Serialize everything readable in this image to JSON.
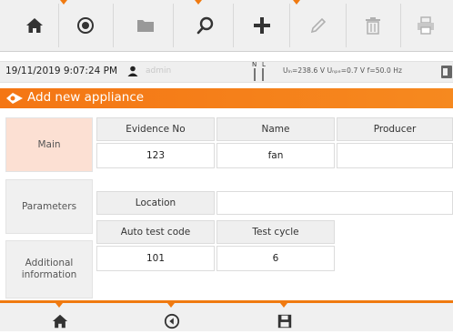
{
  "toolbar": {
    "icons": [
      "home-icon",
      "target-icon",
      "folder-icon",
      "search-icon",
      "plus-icon",
      "pencil-icon",
      "trash-icon",
      "print-icon"
    ]
  },
  "status": {
    "datetime": "19/11/2019 9:07:24 PM",
    "user": "admin",
    "measurement": "Uₗₙ=238.6 V Uₙₚₑ=0.7 V f=50.0 Hz"
  },
  "header": {
    "title": "Add new appliance"
  },
  "sidebar": {
    "tabs": [
      {
        "label": "Main"
      },
      {
        "label": "Parameters"
      },
      {
        "label": "Additional information"
      }
    ]
  },
  "form": {
    "evidence_no": {
      "label": "Evidence No",
      "value": "123"
    },
    "name": {
      "label": "Name",
      "value": "fan"
    },
    "producer": {
      "label": "Producer",
      "value": ""
    },
    "location": {
      "label": "Location",
      "value": ""
    },
    "auto_test_code": {
      "label": "Auto test code",
      "value": "101"
    },
    "test_cycle": {
      "label": "Test cycle",
      "value": "6"
    }
  },
  "bottombar": {
    "icons": [
      "home-icon",
      "back-icon",
      "save-icon"
    ]
  },
  "colors": {
    "accent": "#f47614",
    "active_tab": "#fce0d3",
    "toolbar": "#f0f0f0"
  }
}
